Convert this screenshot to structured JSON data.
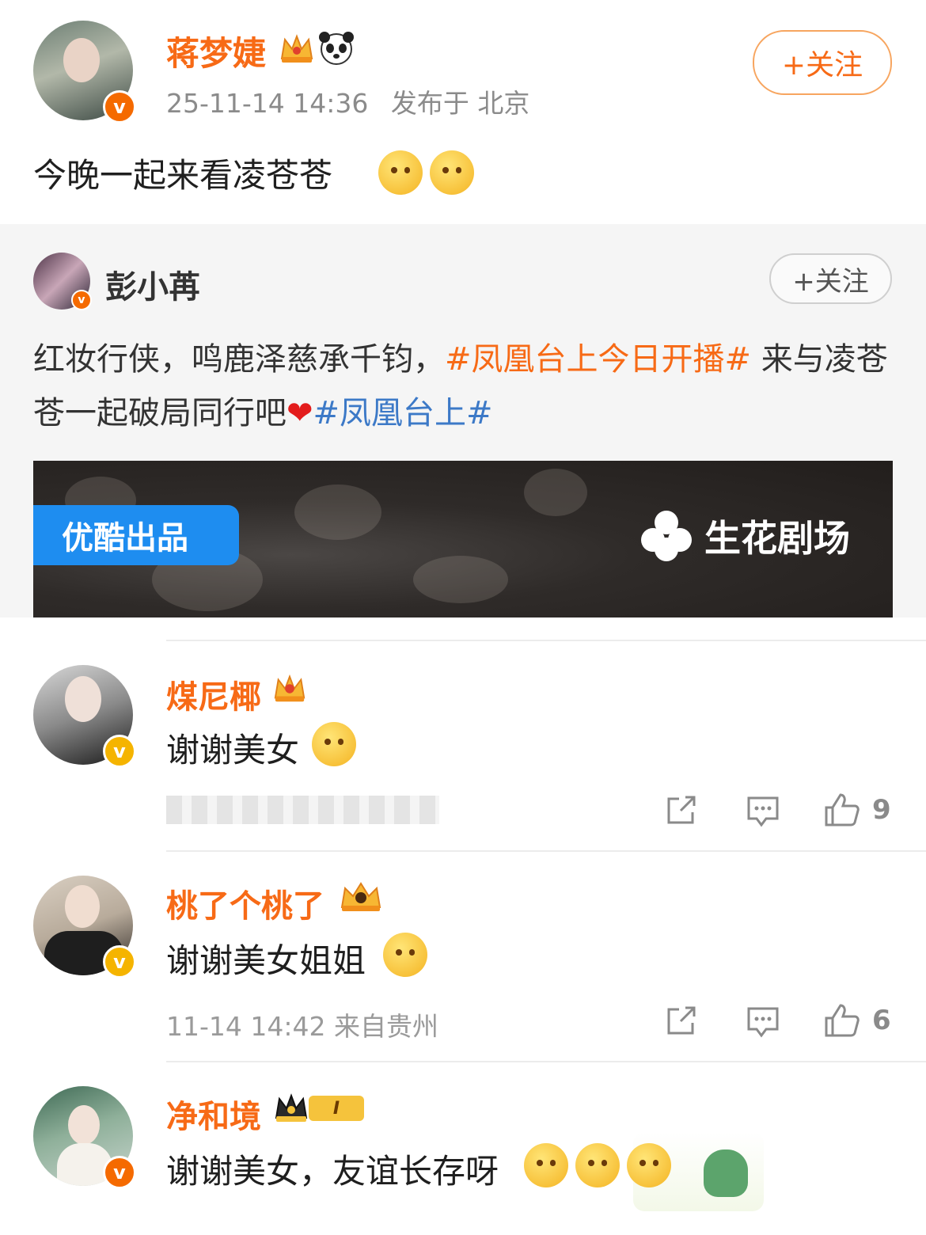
{
  "post": {
    "author": "蒋梦婕",
    "time": "25-11-14 14:36",
    "location": "发布于 北京",
    "follow_label": "+关注",
    "text": "今晚一起来看凌苍苍",
    "crown_icon": "crown-icon",
    "panda_icon": "panda-icon",
    "emojis": [
      "cheer-emoji",
      "cheer-emoji"
    ]
  },
  "repost": {
    "author": "彭小苒",
    "follow_label": "+关注",
    "text_1": "红妆行侠，鸣鹿泽慈承千钧，",
    "tag_1": "#凤凰台上今日开播#",
    "text_2": " 来与凌苍苍一起破局同行吧",
    "heart": "❤",
    "tag_2": "#凤凰台上#",
    "banner": {
      "badge": "优酷出品",
      "brand": "生花剧场"
    }
  },
  "comments": [
    {
      "name": "煤尼椰",
      "text": "谢谢美女",
      "meta": "",
      "likes": "9"
    },
    {
      "name": "桃了个桃了",
      "text": "谢谢美女姐姐",
      "meta": "11-14 14:42  来自贵州",
      "likes": "6"
    },
    {
      "name": "净和境",
      "level": "I",
      "text": "谢谢美女，友谊长存呀"
    }
  ],
  "colors": {
    "accent": "#f76a16",
    "topic_blue": "#3c79c7",
    "verified_orange": "#f56a00",
    "verified_gold": "#f5b400"
  }
}
